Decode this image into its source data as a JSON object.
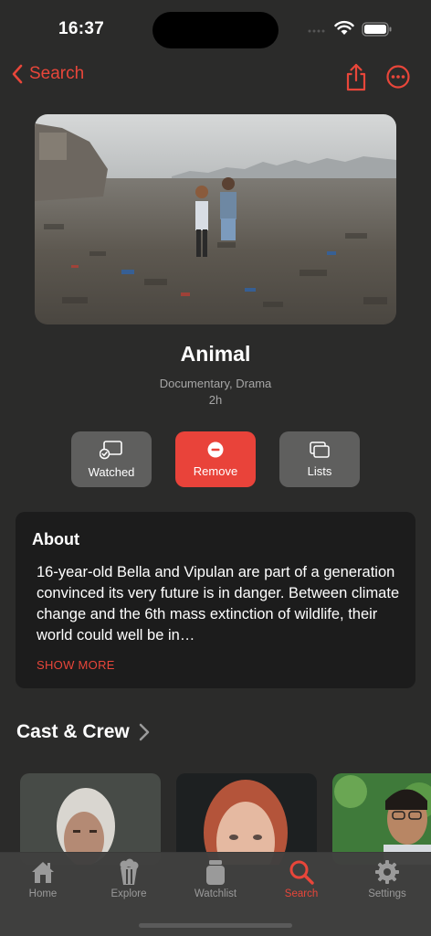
{
  "status": {
    "time": "16:37"
  },
  "nav": {
    "back_label": "Search"
  },
  "movie": {
    "title": "Animal",
    "genres": "Documentary, Drama",
    "runtime": "2h"
  },
  "actions": [
    {
      "label": "Watched",
      "icon": "watched-icon"
    },
    {
      "label": "Remove",
      "icon": "minus-circle-icon"
    },
    {
      "label": "Lists",
      "icon": "lists-icon"
    }
  ],
  "about": {
    "title": "About",
    "text": "16-year-old Bella and Vipulan are part of a generation convinced its very future is in danger. Between climate change and the 6th mass extinction of wildlife, their world could well be in…",
    "show_more": "SHOW MORE"
  },
  "cast": {
    "title": "Cast & Crew"
  },
  "tabs": [
    {
      "label": "Home",
      "icon": "house-icon"
    },
    {
      "label": "Explore",
      "icon": "popcorn-icon"
    },
    {
      "label": "Watchlist",
      "icon": "jar-icon"
    },
    {
      "label": "Search",
      "icon": "search-icon",
      "active": true
    },
    {
      "label": "Settings",
      "icon": "gear-icon"
    }
  ],
  "colors": {
    "accent": "#e8463a",
    "background": "#2b2b2a",
    "card": "#1c1c1c"
  }
}
